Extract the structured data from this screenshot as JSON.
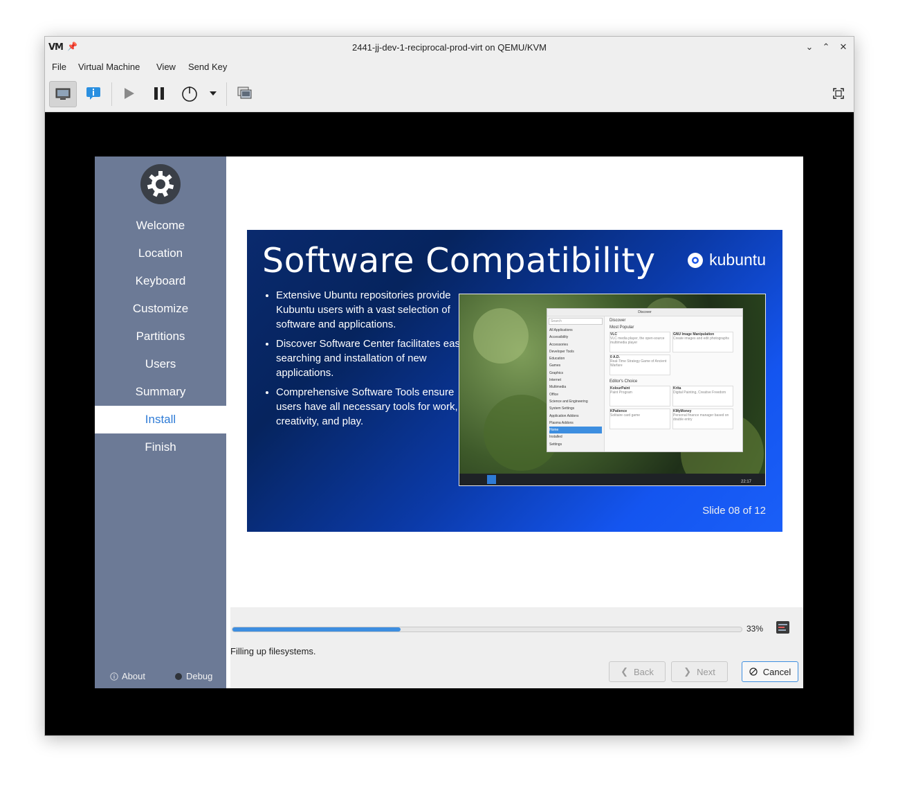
{
  "window": {
    "app_logo": "VM",
    "title": "2441-jj-dev-1-reciprocal-prod-virt on QEMU/KVM",
    "controls": [
      "minimize-icon",
      "maximize-icon",
      "close-icon"
    ]
  },
  "menu": {
    "items": [
      "File",
      "Virtual Machine",
      "View",
      "Send Key"
    ]
  },
  "toolbar": {
    "buttons": [
      "console-icon",
      "details-icon",
      "run-icon",
      "pause-icon",
      "power-icon",
      "dropdown-icon",
      "snapshots-icon",
      "fullscreen-icon"
    ]
  },
  "installer": {
    "steps": [
      "Welcome",
      "Location",
      "Keyboard",
      "Customize",
      "Partitions",
      "Users",
      "Summary",
      "Install",
      "Finish"
    ],
    "active_step": "Install",
    "about_label": "About",
    "debug_label": "Debug"
  },
  "slide": {
    "title": "Software Compatibility",
    "brand": "kubuntu",
    "bullets": [
      "Extensive Ubuntu repositories provide Kubuntu users with a vast selection of software and applications.",
      "Discover Software Center facilitates easy searching and installation of new applications.",
      "Comprehensive Software Tools ensure users have all necessary tools for work, creativity, and play."
    ],
    "slide_number": "Slide 08 of 12",
    "screenshot": {
      "window_title": "Discover",
      "search_placeholder": "Search",
      "sidebar_items": [
        "All Applications",
        "Accessibility",
        "Accessories",
        "Developer Tools",
        "Education",
        "Games",
        "Graphics",
        "Internet",
        "Multimedia",
        "Office",
        "Science and Engineering",
        "System Settings",
        "Application Addons",
        "Plasma Addons",
        "Home",
        "Installed",
        "Settings"
      ],
      "sections": [
        {
          "heading": "Most Popular",
          "apps": [
            {
              "name": "VLC",
              "desc": "VLC media player, the open-source multimedia player"
            },
            {
              "name": "GNU Image Manipulation",
              "desc": "Create images and edit photographs"
            },
            {
              "name": "0 A.D.",
              "desc": "Real-Time Strategy Game of Ancient Warfare"
            }
          ]
        },
        {
          "heading": "Editor's Choice",
          "apps": [
            {
              "name": "KolourPaint",
              "desc": "Paint Program"
            },
            {
              "name": "Krita",
              "desc": "Digital Painting, Creative Freedom"
            },
            {
              "name": "KPatience",
              "desc": "Solitaire card game"
            },
            {
              "name": "KMyMoney",
              "desc": "Personal finance manager based on double entry"
            }
          ]
        }
      ],
      "clock": "22:17"
    }
  },
  "progress": {
    "value": 0.33,
    "label": "33%"
  },
  "status_text": "Filling up filesystems.",
  "nav": {
    "back": "Back",
    "next": "Next",
    "cancel": "Cancel"
  },
  "colors": {
    "sidebar": "#6c7a96",
    "accent": "#3d8ee0",
    "active_step_text": "#2e7bd6"
  }
}
